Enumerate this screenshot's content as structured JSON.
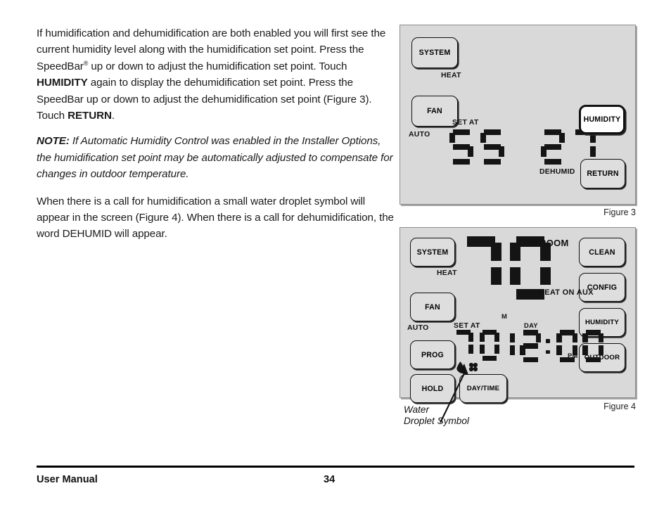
{
  "page": {
    "footer_left": "User Manual",
    "page_number": "34"
  },
  "body_text": {
    "paragraph1_part1": "If humidification and dehumidification are both enabled you will first see the current humidity level along with the humidification set point. Press the SpeedBar",
    "paragraph1_reg": "®",
    "paragraph1_part2": " up or down to adjust the humidification set point. Touch ",
    "paragraph1_bold1": "HUMIDITY",
    "paragraph1_part3": " again to display the dehumidification set point. Press the SpeedBar up or down to adjust the dehumidification set point (Figure 3). Touch ",
    "paragraph1_bold2": "RETURN",
    "paragraph1_part4": ".",
    "note_label": "NOTE:",
    "note_text": " If Automatic Humidity Control was enabled in the Installer Options, the humidification set point may be automatically adjusted to compensate for changes in outdoor temperature.",
    "paragraph2": "When there is a call for humidification a small water droplet symbol will appear in the screen (Figure 4). When there is a call for dehumidification, the word DEHUMID will appear."
  },
  "figure3": {
    "caption": "Figure 3",
    "buttons": {
      "system": "SYSTEM",
      "fan": "FAN",
      "humidity": "HUMIDITY",
      "return": "RETURN"
    },
    "labels": {
      "heat": "HEAT",
      "auto": "AUTO",
      "set_at": "SET AT",
      "dehumid": "DEHUMID"
    },
    "display": {
      "humidification_setpoint": "55",
      "dehumidification_setpoint": "27"
    },
    "active_button": "HUMIDITY"
  },
  "figure4": {
    "caption": "Figure 4",
    "buttons_left": [
      {
        "label": "SYSTEM",
        "sublabel": "HEAT"
      },
      {
        "label": "FAN",
        "sublabel": "AUTO"
      },
      {
        "label": "PROG",
        "sublabel": ""
      },
      {
        "label": "HOLD",
        "sublabel": ""
      },
      {
        "label": "DAY/TIME",
        "sublabel": ""
      }
    ],
    "buttons_right": [
      {
        "label": "CLEAN"
      },
      {
        "label": "CONFIG"
      },
      {
        "label": "HUMIDITY"
      },
      {
        "label": "OUTDOOR"
      }
    ],
    "labels": {
      "room": "ROOM",
      "heat_on_aux": "HEAT ON AUX",
      "set_at": "SET AT",
      "day_letter": "M",
      "day": "DAY",
      "pm": "PM"
    },
    "display": {
      "room_temperature": "70",
      "set_point": "70",
      "clock_hours": "12",
      "clock_minutes": "00"
    },
    "icons": {
      "droplet": "water-droplet-icon",
      "fan": "fan-blower-icon"
    },
    "callout": "Water\nDroplet Symbol"
  },
  "colors": {
    "panel_background": "#d9d9d9",
    "button_background": "#dedede",
    "button_active_background": "#ffffff",
    "segment_color": "#141414",
    "text_color": "#111111"
  }
}
